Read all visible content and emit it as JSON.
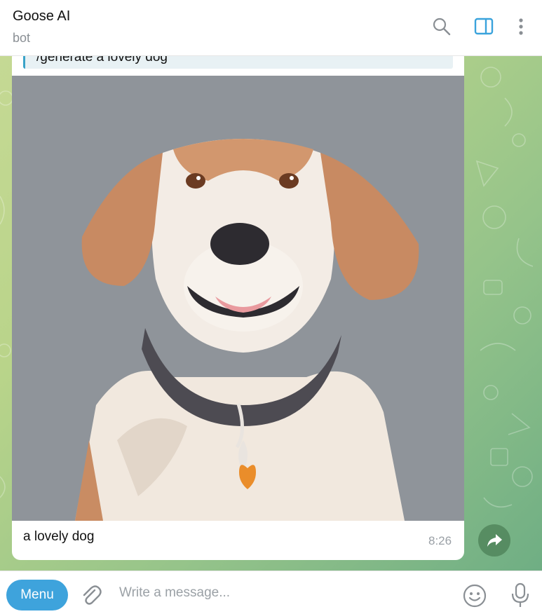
{
  "header": {
    "title": "Goose AI",
    "subtitle": "bot",
    "icons": [
      "search-icon",
      "side-panel-icon",
      "more-vertical-icon"
    ],
    "accent": "#3aa3dc"
  },
  "message": {
    "reply_quote": "/generate a lovely dog",
    "caption": "a lovely dog",
    "time": "8:26",
    "image": "dog-illustration"
  },
  "composer": {
    "menu_label": "Menu",
    "placeholder": "Write a message...",
    "menu_color": "#3ea3dc"
  }
}
